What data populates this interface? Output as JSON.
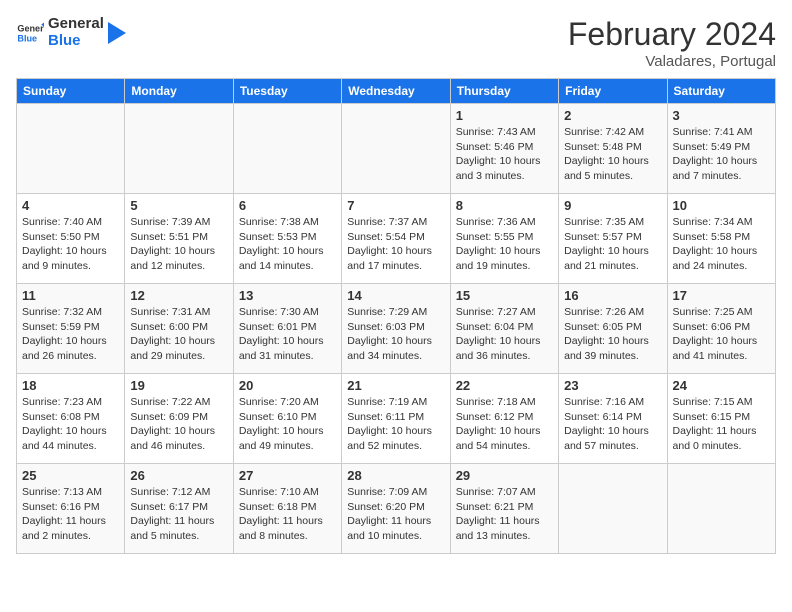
{
  "header": {
    "logo_line1": "General",
    "logo_line2": "Blue",
    "month": "February 2024",
    "location": "Valadares, Portugal"
  },
  "days_of_week": [
    "Sunday",
    "Monday",
    "Tuesday",
    "Wednesday",
    "Thursday",
    "Friday",
    "Saturday"
  ],
  "weeks": [
    [
      {
        "num": "",
        "info": ""
      },
      {
        "num": "",
        "info": ""
      },
      {
        "num": "",
        "info": ""
      },
      {
        "num": "",
        "info": ""
      },
      {
        "num": "1",
        "info": "Sunrise: 7:43 AM\nSunset: 5:46 PM\nDaylight: 10 hours\nand 3 minutes."
      },
      {
        "num": "2",
        "info": "Sunrise: 7:42 AM\nSunset: 5:48 PM\nDaylight: 10 hours\nand 5 minutes."
      },
      {
        "num": "3",
        "info": "Sunrise: 7:41 AM\nSunset: 5:49 PM\nDaylight: 10 hours\nand 7 minutes."
      }
    ],
    [
      {
        "num": "4",
        "info": "Sunrise: 7:40 AM\nSunset: 5:50 PM\nDaylight: 10 hours\nand 9 minutes."
      },
      {
        "num": "5",
        "info": "Sunrise: 7:39 AM\nSunset: 5:51 PM\nDaylight: 10 hours\nand 12 minutes."
      },
      {
        "num": "6",
        "info": "Sunrise: 7:38 AM\nSunset: 5:53 PM\nDaylight: 10 hours\nand 14 minutes."
      },
      {
        "num": "7",
        "info": "Sunrise: 7:37 AM\nSunset: 5:54 PM\nDaylight: 10 hours\nand 17 minutes."
      },
      {
        "num": "8",
        "info": "Sunrise: 7:36 AM\nSunset: 5:55 PM\nDaylight: 10 hours\nand 19 minutes."
      },
      {
        "num": "9",
        "info": "Sunrise: 7:35 AM\nSunset: 5:57 PM\nDaylight: 10 hours\nand 21 minutes."
      },
      {
        "num": "10",
        "info": "Sunrise: 7:34 AM\nSunset: 5:58 PM\nDaylight: 10 hours\nand 24 minutes."
      }
    ],
    [
      {
        "num": "11",
        "info": "Sunrise: 7:32 AM\nSunset: 5:59 PM\nDaylight: 10 hours\nand 26 minutes."
      },
      {
        "num": "12",
        "info": "Sunrise: 7:31 AM\nSunset: 6:00 PM\nDaylight: 10 hours\nand 29 minutes."
      },
      {
        "num": "13",
        "info": "Sunrise: 7:30 AM\nSunset: 6:01 PM\nDaylight: 10 hours\nand 31 minutes."
      },
      {
        "num": "14",
        "info": "Sunrise: 7:29 AM\nSunset: 6:03 PM\nDaylight: 10 hours\nand 34 minutes."
      },
      {
        "num": "15",
        "info": "Sunrise: 7:27 AM\nSunset: 6:04 PM\nDaylight: 10 hours\nand 36 minutes."
      },
      {
        "num": "16",
        "info": "Sunrise: 7:26 AM\nSunset: 6:05 PM\nDaylight: 10 hours\nand 39 minutes."
      },
      {
        "num": "17",
        "info": "Sunrise: 7:25 AM\nSunset: 6:06 PM\nDaylight: 10 hours\nand 41 minutes."
      }
    ],
    [
      {
        "num": "18",
        "info": "Sunrise: 7:23 AM\nSunset: 6:08 PM\nDaylight: 10 hours\nand 44 minutes."
      },
      {
        "num": "19",
        "info": "Sunrise: 7:22 AM\nSunset: 6:09 PM\nDaylight: 10 hours\nand 46 minutes."
      },
      {
        "num": "20",
        "info": "Sunrise: 7:20 AM\nSunset: 6:10 PM\nDaylight: 10 hours\nand 49 minutes."
      },
      {
        "num": "21",
        "info": "Sunrise: 7:19 AM\nSunset: 6:11 PM\nDaylight: 10 hours\nand 52 minutes."
      },
      {
        "num": "22",
        "info": "Sunrise: 7:18 AM\nSunset: 6:12 PM\nDaylight: 10 hours\nand 54 minutes."
      },
      {
        "num": "23",
        "info": "Sunrise: 7:16 AM\nSunset: 6:14 PM\nDaylight: 10 hours\nand 57 minutes."
      },
      {
        "num": "24",
        "info": "Sunrise: 7:15 AM\nSunset: 6:15 PM\nDaylight: 11 hours\nand 0 minutes."
      }
    ],
    [
      {
        "num": "25",
        "info": "Sunrise: 7:13 AM\nSunset: 6:16 PM\nDaylight: 11 hours\nand 2 minutes."
      },
      {
        "num": "26",
        "info": "Sunrise: 7:12 AM\nSunset: 6:17 PM\nDaylight: 11 hours\nand 5 minutes."
      },
      {
        "num": "27",
        "info": "Sunrise: 7:10 AM\nSunset: 6:18 PM\nDaylight: 11 hours\nand 8 minutes."
      },
      {
        "num": "28",
        "info": "Sunrise: 7:09 AM\nSunset: 6:20 PM\nDaylight: 11 hours\nand 10 minutes."
      },
      {
        "num": "29",
        "info": "Sunrise: 7:07 AM\nSunset: 6:21 PM\nDaylight: 11 hours\nand 13 minutes."
      },
      {
        "num": "",
        "info": ""
      },
      {
        "num": "",
        "info": ""
      }
    ]
  ]
}
